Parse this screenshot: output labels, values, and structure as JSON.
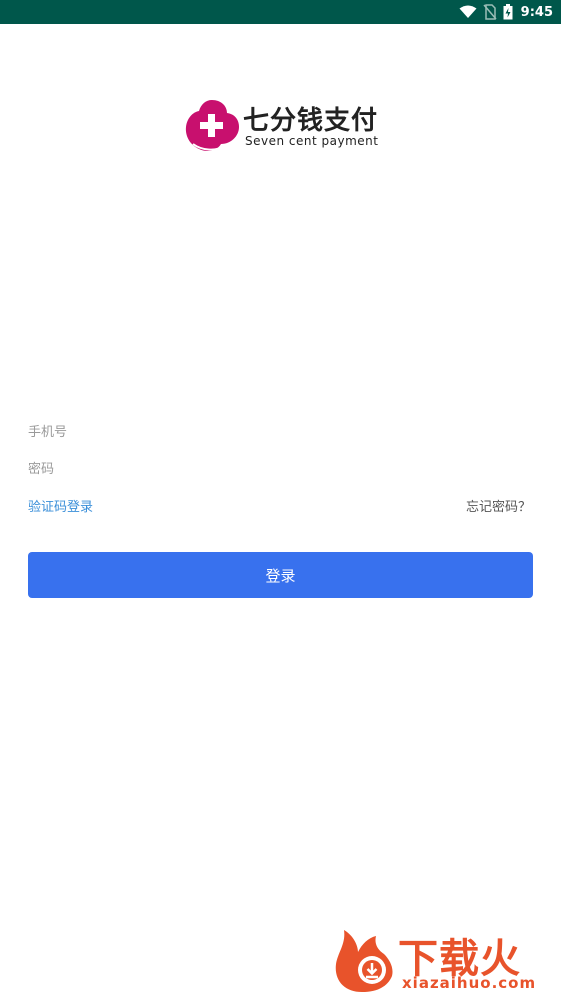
{
  "status_bar": {
    "time": "9:45",
    "icons": [
      "wifi-icon",
      "no-sim-icon",
      "battery-charging-icon"
    ]
  },
  "logo": {
    "title": "七分钱支付",
    "subtitle": "Seven cent payment",
    "brand_color": "#C8106E"
  },
  "form": {
    "phone_placeholder": "手机号",
    "password_placeholder": "密码",
    "sms_login_link": "验证码登录",
    "forgot_password_link": "忘记密码？",
    "login_button": "登录",
    "button_color": "#3871EE",
    "link_color": "#3B8FD9"
  },
  "watermark": {
    "title": "下载火",
    "subtitle": "xiazaihuo.com",
    "color": "#E8532B"
  }
}
